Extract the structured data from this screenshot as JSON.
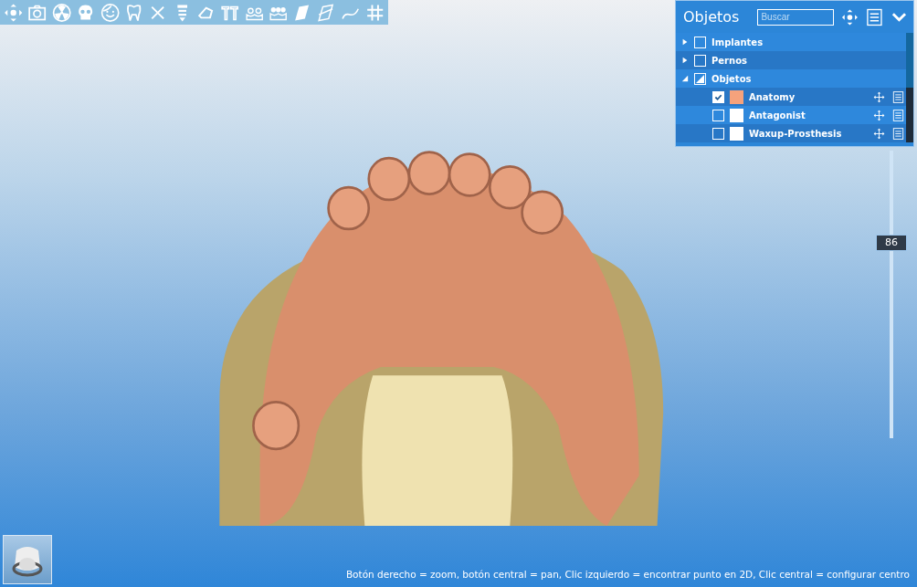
{
  "objects_panel": {
    "title": "Objetos",
    "search": {
      "placeholder": "Buscar"
    },
    "groups": [
      {
        "label": "Implantes",
        "expanded": false,
        "checked": false,
        "mixed": false
      },
      {
        "label": "Pernos",
        "expanded": false,
        "checked": false,
        "mixed": false
      },
      {
        "label": "Objetos",
        "expanded": true,
        "mixed": true,
        "children": [
          {
            "label": "Anatomy",
            "checked": true,
            "color": "#f5a27c"
          },
          {
            "label": "Antagonist",
            "checked": false,
            "color": "#ffffff"
          },
          {
            "label": "Waxup-Prosthesis",
            "checked": false,
            "color": "#ffffff"
          }
        ]
      }
    ]
  },
  "slider": {
    "reading": "86",
    "level": 0.68
  },
  "status_bar": {
    "hint": "Botón derecho = zoom, botón central = pan, Clic izquierdo = encontrar punto en 2D, Clic central = configurar centro"
  }
}
